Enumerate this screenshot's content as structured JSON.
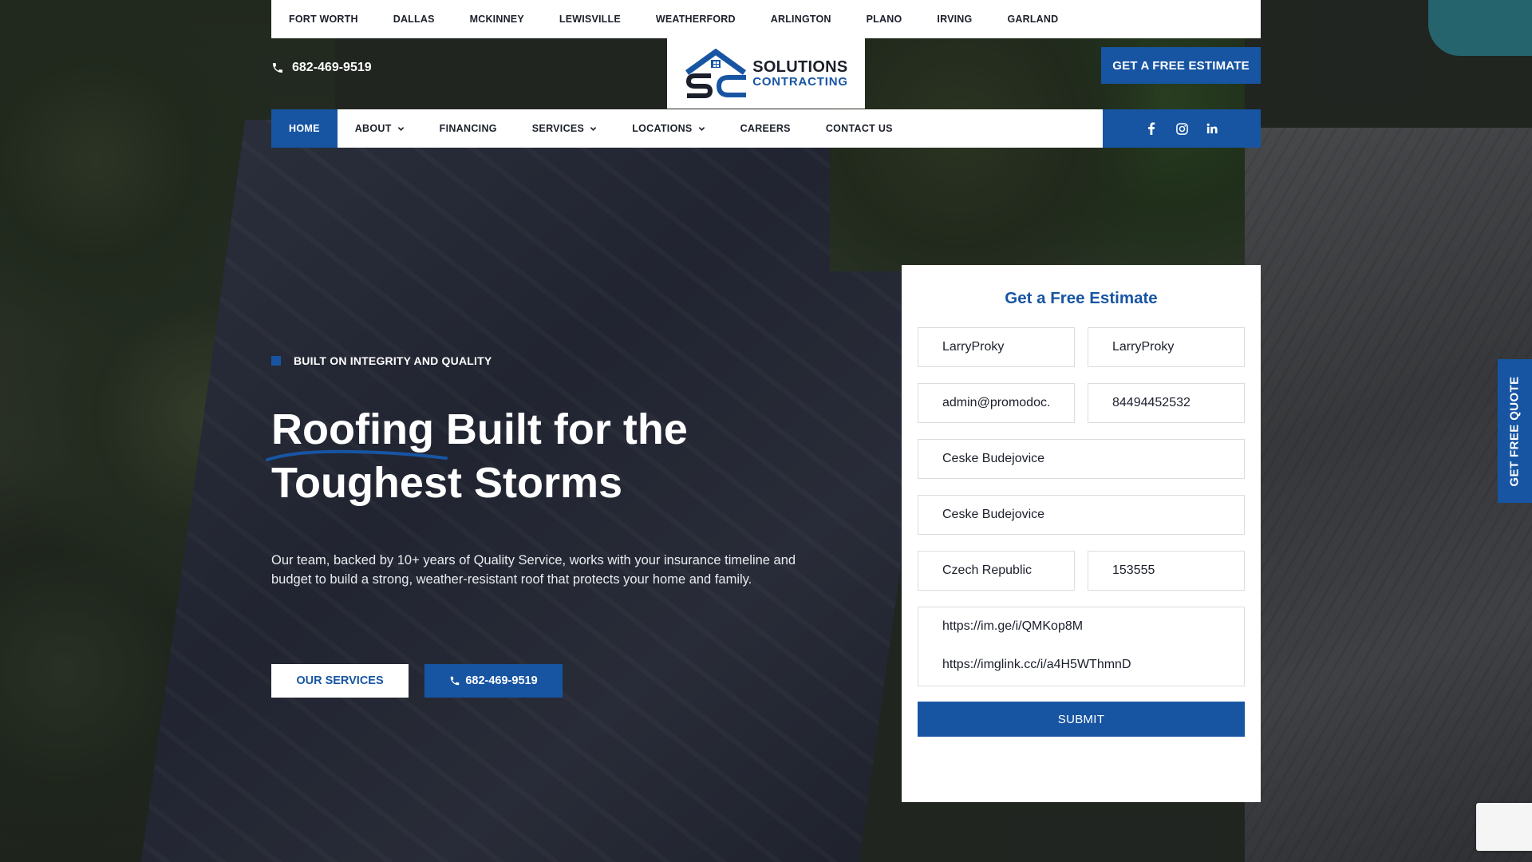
{
  "cities": [
    "FORT WORTH",
    "DALLAS",
    "MCKINNEY",
    "LEWISVILLE",
    "WEATHERFORD",
    "ARLINGTON",
    "PLANO",
    "IRVING",
    "GARLAND"
  ],
  "header": {
    "phone": "682-469-9519",
    "logo_line1": "SOLUTIONS",
    "logo_line2": "CONTRACTING",
    "estimate_button": "GET A FREE ESTIMATE"
  },
  "nav": {
    "home": "HOME",
    "about": "ABOUT",
    "financing": "FINANCING",
    "services": "SERVICES",
    "locations": "LOCATIONS",
    "careers": "CAREERS",
    "contact": "CONTACT US"
  },
  "social": [
    "facebook-icon",
    "instagram-icon",
    "linkedin-icon"
  ],
  "hero": {
    "tag": "BUILT ON INTEGRITY AND QUALITY",
    "title_line1": "Roofing Built for the",
    "title_line2": "Toughest Storms",
    "description": "Our team, backed by 10+ years of Quality Service, works with your insurance timeline and budget to build a strong, weather-resistant roof that protects your home and family.",
    "services_button": "OUR SERVICES",
    "call_button": "682-469-9519"
  },
  "form": {
    "title": "Get a Free Estimate",
    "first_name": "LarryProky",
    "last_name": "LarryProky",
    "email": "admin@promodoc.ru",
    "phone": "84494452532",
    "address": "Ceske Budejovice",
    "city": "Ceske Budejovice",
    "country": "Czech Republic",
    "zip": "153555",
    "message": "https://im.ge/i/QMKop8M\nhttps://imglink.cc/i/a4H5WThmnD",
    "submit": "SUBMIT"
  },
  "side_tab": "GET FREE QUOTE",
  "colors": {
    "brand_blue": "#1755a3",
    "dark_text": "#1b1f2a",
    "white": "#ffffff"
  }
}
